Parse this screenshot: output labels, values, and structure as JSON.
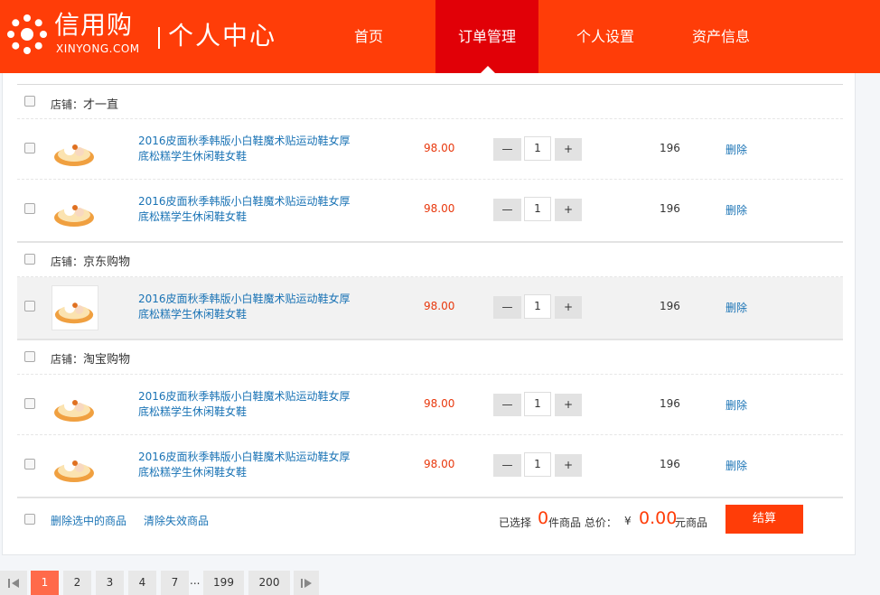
{
  "header": {
    "brand_name": "信用购",
    "brand_sub": "XINYONG.COM",
    "section_title": "个人中心",
    "nav": [
      {
        "label": "首页",
        "active": false
      },
      {
        "label": "订单管理",
        "active": true
      },
      {
        "label": "个人设置",
        "active": false
      },
      {
        "label": "资产信息",
        "active": false
      }
    ]
  },
  "cart": {
    "store_prefix": "店铺：",
    "stores": [
      {
        "name": "才一直",
        "items": [
          {
            "title": "2016皮面秋季韩版小白鞋魔术贴运动鞋女厚底松糕学生休闲鞋女鞋",
            "price": "98.00",
            "qty": "1",
            "subtotal": "196",
            "delete_label": "删除",
            "minus": "—",
            "plus": "+"
          },
          {
            "title": "2016皮面秋季韩版小白鞋魔术贴运动鞋女厚底松糕学生休闲鞋女鞋",
            "price": "98.00",
            "qty": "1",
            "subtotal": "196",
            "delete_label": "删除",
            "minus": "—",
            "plus": "+"
          }
        ]
      },
      {
        "name": "京东购物",
        "items": [
          {
            "title": "2016皮面秋季韩版小白鞋魔术贴运动鞋女厚底松糕学生休闲鞋女鞋",
            "price": "98.00",
            "qty": "1",
            "subtotal": "196",
            "delete_label": "删除",
            "minus": "—",
            "plus": "+"
          }
        ]
      },
      {
        "name": "淘宝购物",
        "items": [
          {
            "title": "2016皮面秋季韩版小白鞋魔术贴运动鞋女厚底松糕学生休闲鞋女鞋",
            "price": "98.00",
            "qty": "1",
            "subtotal": "196",
            "delete_label": "删除",
            "minus": "—",
            "plus": "+"
          },
          {
            "title": "2016皮面秋季韩版小白鞋魔术贴运动鞋女厚底松糕学生休闲鞋女鞋",
            "price": "98.00",
            "qty": "1",
            "subtotal": "196",
            "delete_label": "删除",
            "minus": "—",
            "plus": "+"
          }
        ]
      }
    ],
    "footer": {
      "delete_selected": "删除选中的商品",
      "clear_invalid": "清除失效商品",
      "selected_prefix": "已选择",
      "selected_count": "0",
      "selected_suffix": "件商品 总价：",
      "currency": "¥",
      "total": "0.00",
      "total_unit": "元商品",
      "checkout_label": "结算"
    }
  },
  "pagination": {
    "prev_icon": "prev-icon",
    "next_icon": "next-icon",
    "pages": [
      "1",
      "2",
      "3",
      "4",
      "7",
      "199",
      "200"
    ],
    "current": "1",
    "ellipsis": "..."
  },
  "colors": {
    "brand": "#ff3d08",
    "nav_active": "#e10007",
    "link": "#1a73b5",
    "price": "#e8380d"
  }
}
